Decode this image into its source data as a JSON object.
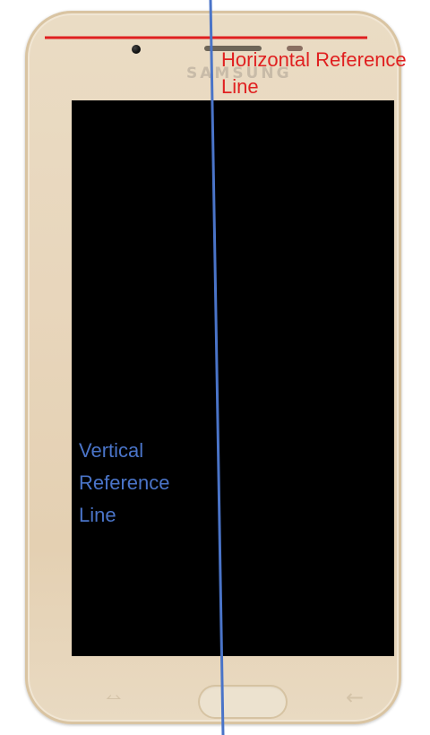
{
  "photo": {
    "subject": "Samsung smartphone, front view, gold body",
    "brand_logo": "SAMSUNG",
    "screen_state": "off",
    "buttons": {
      "recent_apps_icon": "⥎",
      "back_icon": "←"
    }
  },
  "annotations": {
    "horizontal_label": "Horizontal Reference\nLine",
    "vertical_label": "Vertical\nReference\nLine",
    "horizontal_line_color": "#e02020",
    "vertical_line_color": "#4a74c8"
  }
}
